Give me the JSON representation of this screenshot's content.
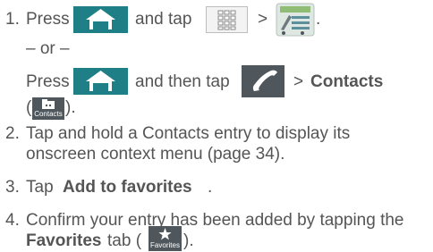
{
  "steps": [
    {
      "number": "1.",
      "press": "Press",
      "and_tap": "and tap",
      "gt": ">",
      "period": "."
    },
    {
      "number": "2.",
      "line1": "Tap and hold a Contacts entry to display its",
      "line2": "onscreen context menu (page 34)."
    },
    {
      "number": "3.",
      "tap": "Tap",
      "action": "Add to favorites",
      "period": "."
    },
    {
      "number": "4.",
      "line1": "Confirm your entry has been added by tapping the",
      "tab_name": "Favorites",
      "tab_word": "tab (",
      "close": ")."
    }
  ],
  "alt": {
    "or": "– or –",
    "press": "Press",
    "and_then_tap": "and then tap",
    "gt": ">",
    "contacts": "Contacts",
    "open_paren": "(",
    "close": ")."
  },
  "icons": {
    "home": "home-key-icon",
    "apps": "applications-grid-icon",
    "settings": "settings-app-icon",
    "phone": "phone-app-icon",
    "contacts": "contacts-tab-icon",
    "favorites": "favorites-tab-icon",
    "contacts_label": "Contacts",
    "favorites_label": "Favorites"
  },
  "colors": {
    "text": "#555555",
    "icon_teal": "#1e7f86",
    "icon_dark": "#4f575d"
  }
}
